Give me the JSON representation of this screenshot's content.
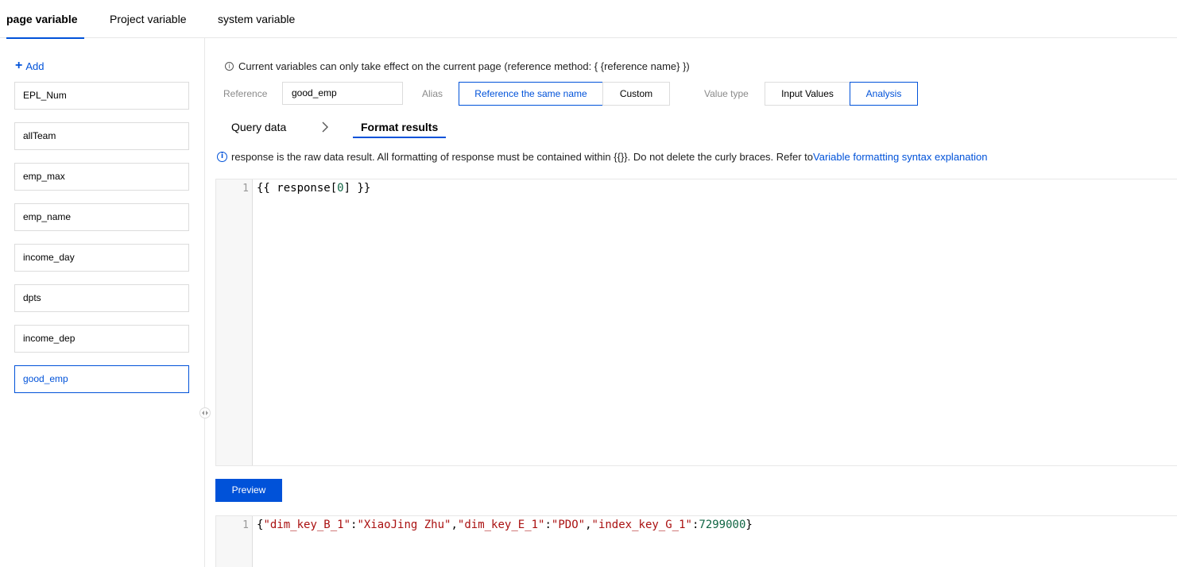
{
  "tabs": {
    "page_variable": "page variable",
    "project_variable": "Project variable",
    "system_variable": "system variable"
  },
  "sidebar": {
    "add_label": "Add",
    "items": [
      {
        "label": "EPL_Num"
      },
      {
        "label": "allTeam"
      },
      {
        "label": "emp_max"
      },
      {
        "label": "emp_name"
      },
      {
        "label": "income_day"
      },
      {
        "label": "dpts"
      },
      {
        "label": "income_dep"
      },
      {
        "label": "good_emp",
        "selected": true
      }
    ]
  },
  "main": {
    "info_text": "Current variables can only take effect on the current page (reference method: { {reference name} })",
    "reference_label": "Reference",
    "reference_value": "good_emp",
    "alias_label": "Alias",
    "alias_options": [
      "Reference the same name",
      "Custom"
    ],
    "alias_selected": "Reference the same name",
    "value_type_label": "Value type",
    "value_type_options": [
      "Input Values",
      "Analysis"
    ],
    "value_type_selected": "Analysis",
    "subtabs": {
      "query": "Query data",
      "format": "Format results"
    },
    "note_text": "response is the raw data result. All formatting of response must be contained within {{}}. Do not delete the curly braces. Refer to",
    "note_link": "Variable formatting syntax explanation",
    "format_editor": {
      "line_number": "1",
      "code_prefix": "{{ response[",
      "code_index": "0",
      "code_suffix": "] }}"
    },
    "preview_label": "Preview",
    "result_editor": {
      "line_number": "1",
      "open_brace": "{",
      "key1": "\"dim_key_B_1\"",
      "colon": ":",
      "val1": "\"XiaoJing Zhu\"",
      "comma": ",",
      "key2": "\"dim_key_E_1\"",
      "val2": "\"PDO\"",
      "key3": "\"index_key_G_1\"",
      "val3": "7299000",
      "close_brace": "}"
    }
  },
  "colors": {
    "accent": "#0052d9",
    "border": "#dcdcdc",
    "muted_label": "#8a8a8a"
  }
}
